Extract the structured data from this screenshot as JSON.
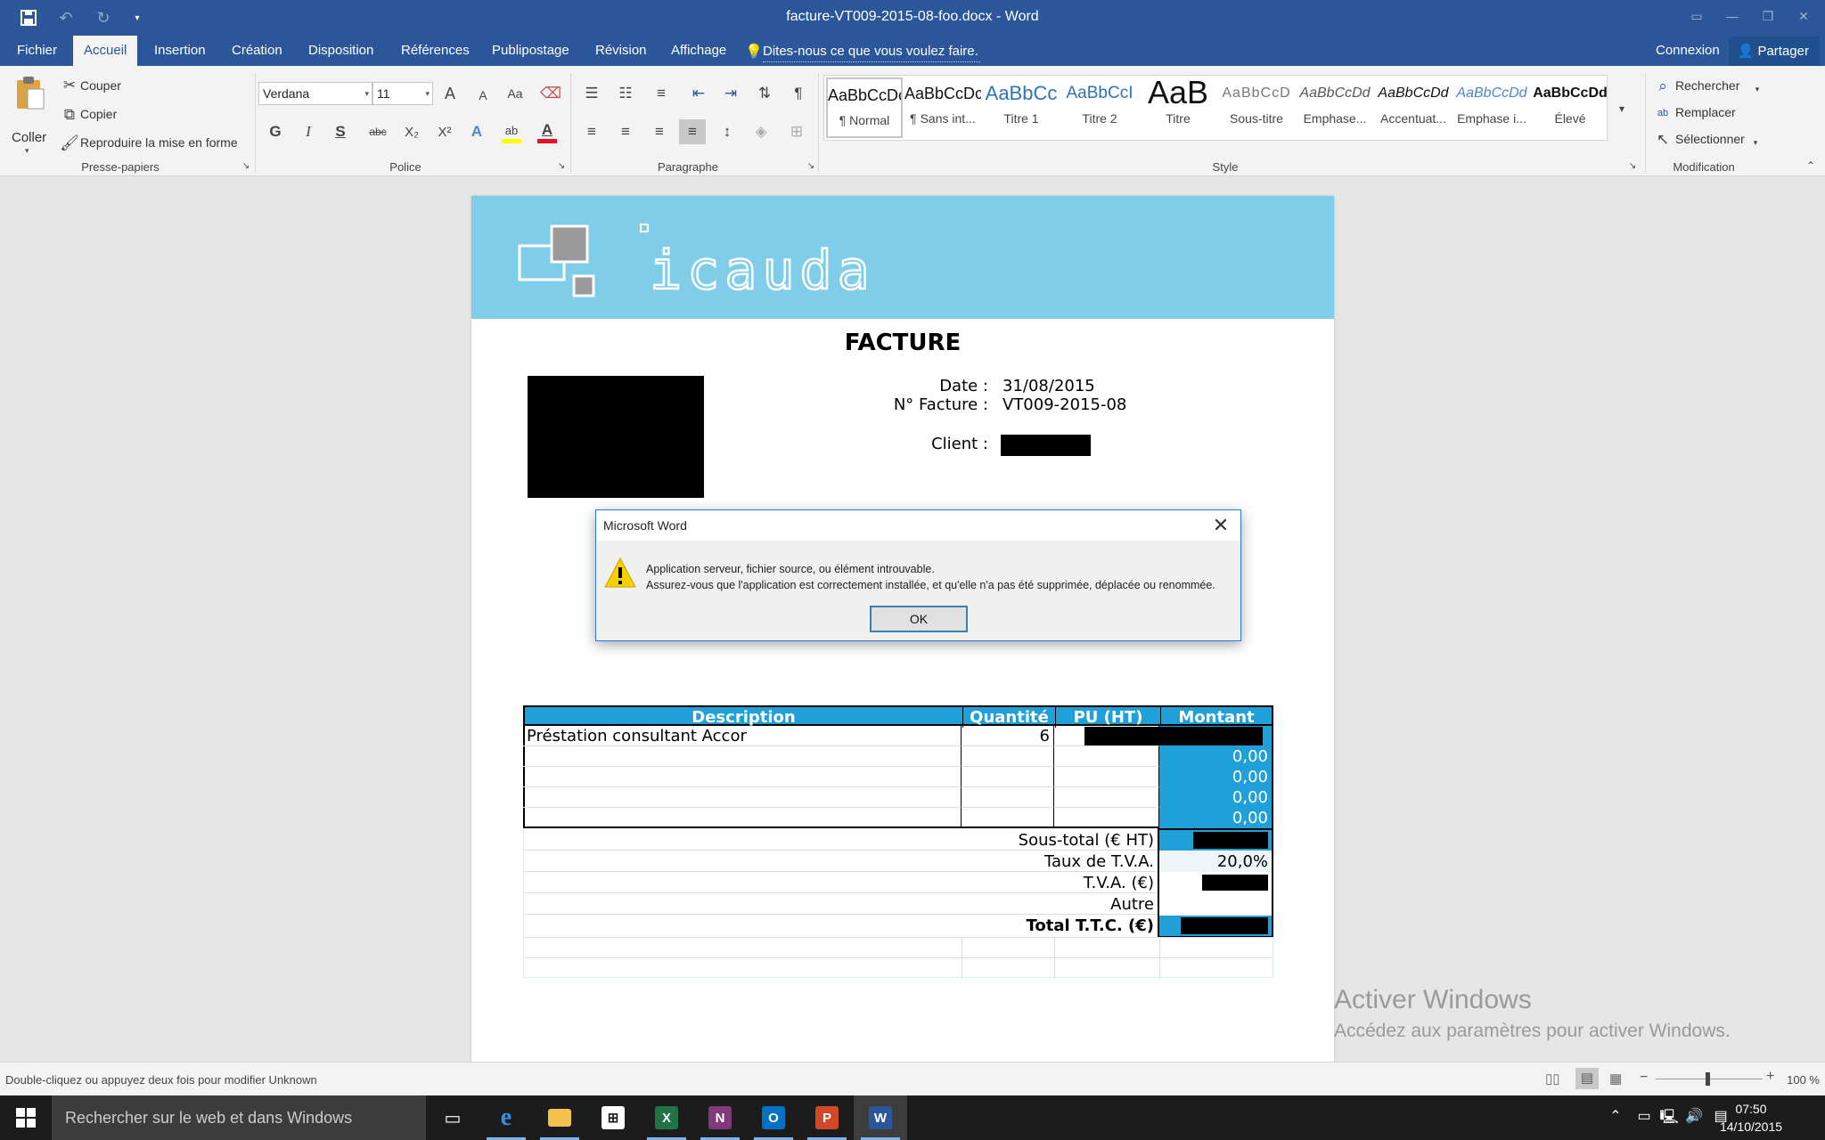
{
  "window": {
    "title": "facture-VT009-2015-08-foo.docx - Word"
  },
  "tabs": [
    {
      "label": "Fichier"
    },
    {
      "label": "Accueil"
    },
    {
      "label": "Insertion"
    },
    {
      "label": "Création"
    },
    {
      "label": "Disposition"
    },
    {
      "label": "Références"
    },
    {
      "label": "Publipostage"
    },
    {
      "label": "Révision"
    },
    {
      "label": "Affichage"
    }
  ],
  "tell_me": "Dites-nous ce que vous voulez faire.",
  "account": {
    "signin": "Connexion",
    "share": "Partager"
  },
  "clipboard": {
    "paste": "Coller",
    "cut": "Couper",
    "copy": "Copier",
    "format_painter": "Reproduire la mise en forme",
    "group": "Presse-papiers"
  },
  "font": {
    "name": "Verdana",
    "size": "11",
    "group": "Police",
    "bold": "G",
    "italic": "I",
    "underline": "S",
    "strike": "abc",
    "subscript": "X₂",
    "superscript": "X²",
    "grow": "A",
    "shrink": "A",
    "case": "Aa",
    "highlight_color": "#ffff00",
    "font_color": "#e81123"
  },
  "paragraph": {
    "group": "Paragraphe"
  },
  "styles": {
    "group": "Style",
    "items": [
      {
        "sample": "AaBbCcDc",
        "name": "¶ Normal"
      },
      {
        "sample": "AaBbCcDc",
        "name": "¶ Sans int..."
      },
      {
        "sample": "AaBbCc",
        "name": "Titre 1"
      },
      {
        "sample": "AaBbCcI",
        "name": "Titre 2"
      },
      {
        "sample": "AaB",
        "name": "Titre"
      },
      {
        "sample": "AaBbCcD",
        "name": "Sous-titre"
      },
      {
        "sample": "AaBbCcDd",
        "name": "Emphase..."
      },
      {
        "sample": "AaBbCcDd",
        "name": "Accentuat..."
      },
      {
        "sample": "AaBbCcDd",
        "name": "Emphase i..."
      },
      {
        "sample": "AaBbCcDd",
        "name": "Élevé"
      }
    ]
  },
  "editing": {
    "find": "Rechercher",
    "replace": "Remplacer",
    "select": "Sélectionner",
    "group": "Modification"
  },
  "document": {
    "logo_text": "icauda",
    "title": "FACTURE",
    "date_label": "Date :",
    "date_value": "31/08/2015",
    "invoice_label": "N° Facture :",
    "invoice_value": "VT009-2015-08",
    "client_label": "Client :",
    "table": {
      "headers": [
        "Description",
        "Quantité",
        "PU (HT)",
        "Montant"
      ],
      "rows": [
        {
          "description": "Préstation consultant Accor",
          "qty": "6",
          "unit": "",
          "amount": ""
        },
        {
          "description": "",
          "qty": "",
          "unit": "",
          "amount": "0,00"
        },
        {
          "description": "",
          "qty": "",
          "unit": "",
          "amount": "0,00"
        },
        {
          "description": "",
          "qty": "",
          "unit": "",
          "amount": "0,00"
        },
        {
          "description": "",
          "qty": "",
          "unit": "",
          "amount": "0,00"
        }
      ],
      "totals": [
        {
          "label": "Sous-total (€ HT)",
          "value": ""
        },
        {
          "label": "Taux de T.V.A.",
          "value": "20,0%"
        },
        {
          "label": "T.V.A. (€)",
          "value": ""
        },
        {
          "label": "Autre",
          "value": ""
        },
        {
          "label": "Total T.T.C. (€)",
          "value": ""
        }
      ]
    }
  },
  "dialog": {
    "title": "Microsoft Word",
    "line1": "Application serveur, fichier source, ou élément introuvable.",
    "line2": "Assurez-vous que l'application est correctement installée, et qu'elle n'a pas été supprimée, déplacée ou renommée.",
    "ok": "OK"
  },
  "watermark": {
    "line1": "Activer Windows",
    "line2": "Accédez aux paramètres pour activer Windows."
  },
  "status": {
    "text": "Double-cliquez ou appuyez deux fois pour modifier Unknown",
    "zoom": "100 %"
  },
  "taskbar": {
    "search_placeholder": "Rechercher sur le web et dans Windows",
    "time": "07:50",
    "date": "14/10/2015"
  },
  "colors": {
    "word_blue": "#2b579a",
    "table_header": "#1fa0d8",
    "banner": "#80cde9"
  }
}
